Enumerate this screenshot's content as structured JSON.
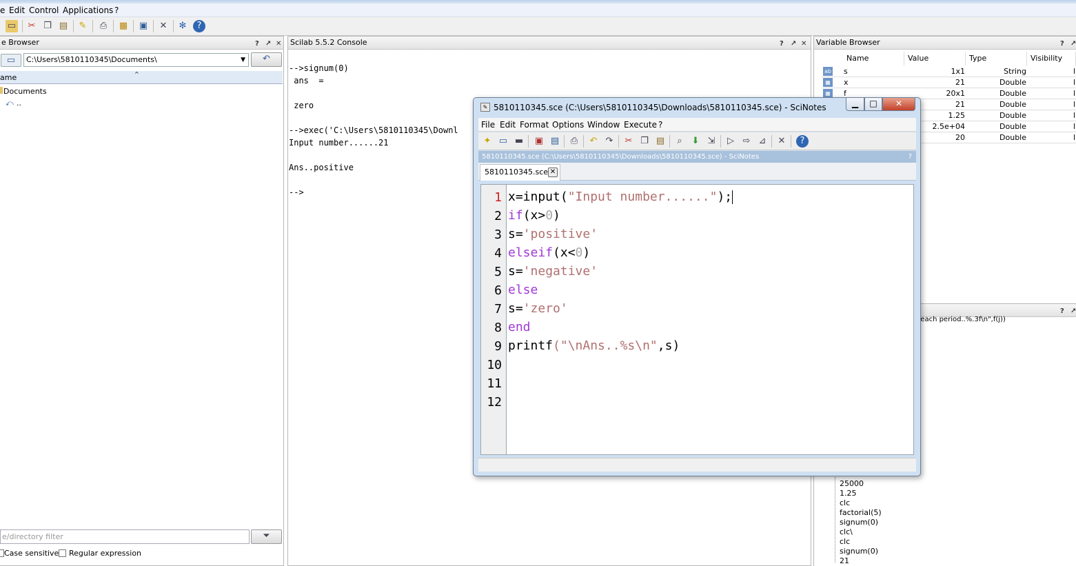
{
  "main_menu": [
    "e",
    "Edit",
    "Control",
    "Applications",
    "?"
  ],
  "file_browser": {
    "title": "e Browser",
    "path": "C:\\Users\\5810110345\\Documents\\",
    "column_name": "ame",
    "tree": [
      "Documents",
      ".."
    ],
    "filter_placeholder": "e/directory filter",
    "case_sensitive_label": "Case sensitive",
    "regex_label": "Regular expression"
  },
  "console": {
    "title": "Scilab 5.5.2 Console",
    "lines": [
      "-->signum(0)",
      " ans  =",
      "",
      " zero",
      "",
      "-->exec('C:\\Users\\5810110345\\Downl",
      "Input number......21",
      "",
      "Ans..positive",
      "",
      "-->"
    ]
  },
  "variable_browser": {
    "title": "Variable Browser",
    "columns": [
      "Name",
      "Value",
      "Type",
      "Visibility"
    ],
    "rows": [
      {
        "name": "s",
        "value": "1x1",
        "type": "String",
        "vis": "l"
      },
      {
        "name": "x",
        "value": "21",
        "type": "Double",
        "vis": "l"
      },
      {
        "name": "f",
        "value": "20x1",
        "type": "Double",
        "vis": "l"
      },
      {
        "name": "",
        "value": "21",
        "type": "Double",
        "vis": "l"
      },
      {
        "name": "",
        "value": "1.25",
        "type": "Double",
        "vis": "l"
      },
      {
        "name": "",
        "value": "2.5e+04",
        "type": "Double",
        "vis": "l"
      },
      {
        "name": "",
        "value": "20",
        "type": "Double",
        "vis": "l"
      }
    ]
  },
  "history": {
    "snippet": "r each period..%.3f\\n\",f(j))",
    "items": [
      "25000",
      "1.25",
      "clc",
      "factorial(5)",
      "signum(0)",
      "clc\\",
      "clc",
      "signum(0)",
      "21"
    ]
  },
  "scinotes": {
    "title": "5810110345.sce (C:\\Users\\5810110345\\Downloads\\5810110345.sce) - SciNotes",
    "menu": [
      "File",
      "Edit",
      "Format",
      "Options",
      "Window",
      "Execute",
      "?"
    ],
    "pathbar": "5810110345.sce (C:\\Users\\5810110345\\Downloads\\5810110345.sce) - SciNotes",
    "pathbar_q": "?",
    "tab_label": "5810110345.sce",
    "line_numbers": [
      "1",
      "2",
      "3",
      "4",
      "5",
      "6",
      "7",
      "8",
      "9",
      "10",
      "11",
      "12"
    ],
    "code": {
      "l1a": "x=input",
      "l1b": "(",
      "l1c": "\"Input number......\"",
      "l1d": ");",
      "l2a": "if",
      "l2b": "(x>",
      "l2c": "0",
      "l2d": ")",
      "l3a": "s=",
      "l3b": "'positive'",
      "l4a": "elseif",
      "l4b": "(x<",
      "l4c": "0",
      "l4d": ")",
      "l5a": "s=",
      "l5b": "'negative'",
      "l6a": "else",
      "l7a": "s=",
      "l7b": "'zero'",
      "l8a": "end",
      "l9a": "printf",
      "l9b": "(",
      "l9c": "\"\\nAns..%s\\n\"",
      "l9d": ",s)"
    }
  },
  "colors": {
    "keyword": "#a038d6",
    "string": "#b07070",
    "current_line_number": "#d02020"
  }
}
